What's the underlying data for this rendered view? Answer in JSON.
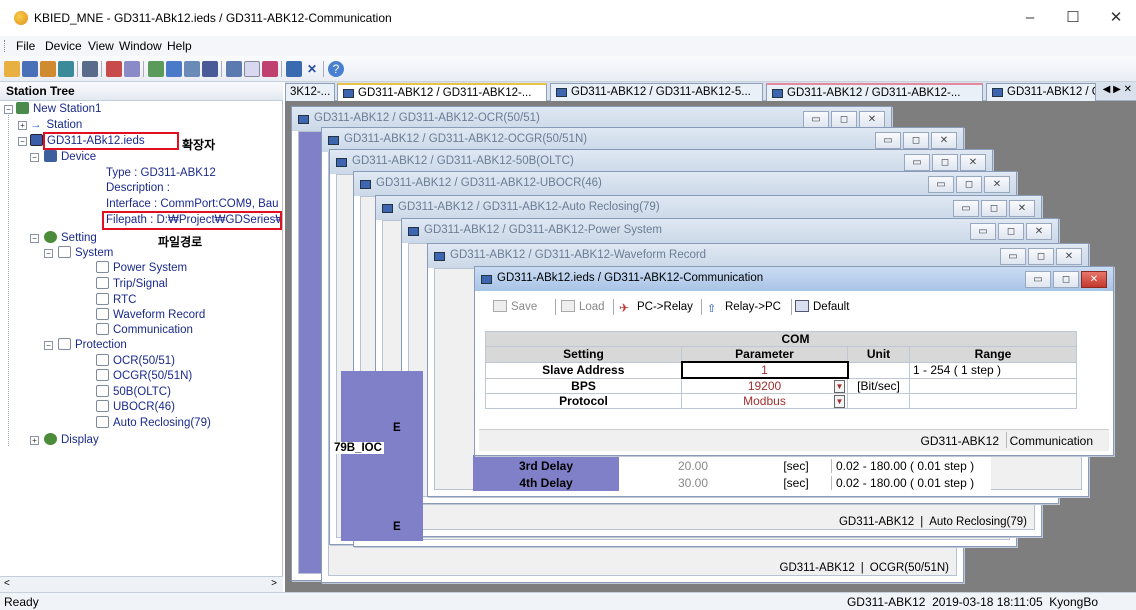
{
  "window": {
    "title": "KBIED_MNE - GD311-ABk12.ieds / GD311-ABK12-Communication",
    "controls": [
      "–",
      "☐",
      "✕"
    ]
  },
  "menu": [
    "File",
    "Device",
    "View",
    "Window",
    "Help"
  ],
  "toolbar_icons": [
    "open-icon",
    "save-icon",
    "export-icon",
    "import-icon",
    "print-icon",
    "connect-icon",
    "disconnect-icon",
    "upload-icon",
    "download-icon",
    "monitor-icon",
    "settings-icon",
    "chart-icon",
    "wave-icon",
    "network-icon",
    "close-icon",
    "help-icon"
  ],
  "tree": {
    "header": "Station Tree",
    "nodes": [
      {
        "label": "New Station1"
      },
      {
        "label": "Station"
      },
      {
        "label": "GD311-ABk12.ieds"
      },
      {
        "label": "Device"
      },
      {
        "label": "Type : GD311-ABK12"
      },
      {
        "label": "Description :"
      },
      {
        "label": "Interface : CommPort:COM9, Bau"
      },
      {
        "label": "Filepath : D:₩Project₩GDSeries₩"
      },
      {
        "label": "Setting"
      },
      {
        "label": "System"
      },
      {
        "label": "Power System"
      },
      {
        "label": "Trip/Signal"
      },
      {
        "label": "RTC"
      },
      {
        "label": "Waveform Record"
      },
      {
        "label": "Communication"
      },
      {
        "label": "Protection"
      },
      {
        "label": "OCR(50/51)"
      },
      {
        "label": "OCGR(50/51N)"
      },
      {
        "label": "50B(OLTC)"
      },
      {
        "label": "UBOCR(46)"
      },
      {
        "label": "Auto Reclosing(79)"
      },
      {
        "label": "Display"
      }
    ],
    "annotations": {
      "extension": "확장자",
      "filepath": "파일경로"
    }
  },
  "tabs": [
    "3K12-...",
    "GD311-ABK12 / GD311-ABK12-...",
    "GD311-ABK12 / GD311-ABK12-5...",
    "GD311-ABK12 / GD311-ABK12-...",
    "GD311-ABK12 / GD..."
  ],
  "windows": {
    "ocr": "GD311-ABK12 / GD311-ABK12-OCR(50/51)",
    "ocgr": "GD311-ABK12 / GD311-ABK12-OCGR(50/51N)",
    "b50": "GD311-ABK12 / GD311-ABK12-50B(OLTC)",
    "ubocr": "GD311-ABK12 / GD311-ABK12-UBOCR(46)",
    "auto": "GD311-ABK12 / GD311-ABK12-Auto Reclosing(79)",
    "power": "GD311-ABK12 / GD311-ABK12-Power System",
    "wave": "GD311-ABK12 / GD311-ABK12-Waveform Record",
    "comm": "GD311-ABk12.ieds / GD311-ABK12-Communication"
  },
  "auto_reclosing": {
    "rows": [
      {
        "name": "3rd Delay",
        "value": "20.00",
        "unit": "[sec]",
        "range": "0.02 - 180.00 ( 0.01 step )"
      },
      {
        "name": "4th Delay",
        "value": "30.00",
        "unit": "[sec]",
        "range": "0.02 - 180.00 ( 0.01 step )"
      }
    ],
    "footer_device": "GD311-ABK12",
    "footer_name": "Auto Reclosing(79)"
  },
  "ocgr_footer": {
    "device": "GD311-ABK12",
    "name": "OCGR(50/51N)"
  },
  "fragments": {
    "label_79b": "79B_IOC",
    "letter_e1": "E",
    "letter_e2": "E",
    "letter_e3": "E"
  },
  "comm": {
    "toolbar": {
      "save": "Save",
      "load": "Load",
      "pc_relay": "PC->Relay",
      "relay_pc": "Relay->PC",
      "default": "Default"
    },
    "group": "COM",
    "headers": {
      "setting": "Setting",
      "parameter": "Parameter",
      "unit": "Unit",
      "range": "Range"
    },
    "rows": [
      {
        "name": "Slave Address",
        "value": "1",
        "unit": "",
        "range": "1 - 254 ( 1 step )"
      },
      {
        "name": "BPS",
        "value": "19200",
        "unit": "[Bit/sec]",
        "range": ""
      },
      {
        "name": "Protocol",
        "value": "Modbus",
        "unit": "",
        "range": ""
      }
    ],
    "footer_device": "GD311-ABK12",
    "footer_name": "Communication"
  },
  "status": {
    "left": "Ready",
    "right": "GD311-ABK12  2019-03-18 18:11:05  KyongBo"
  }
}
